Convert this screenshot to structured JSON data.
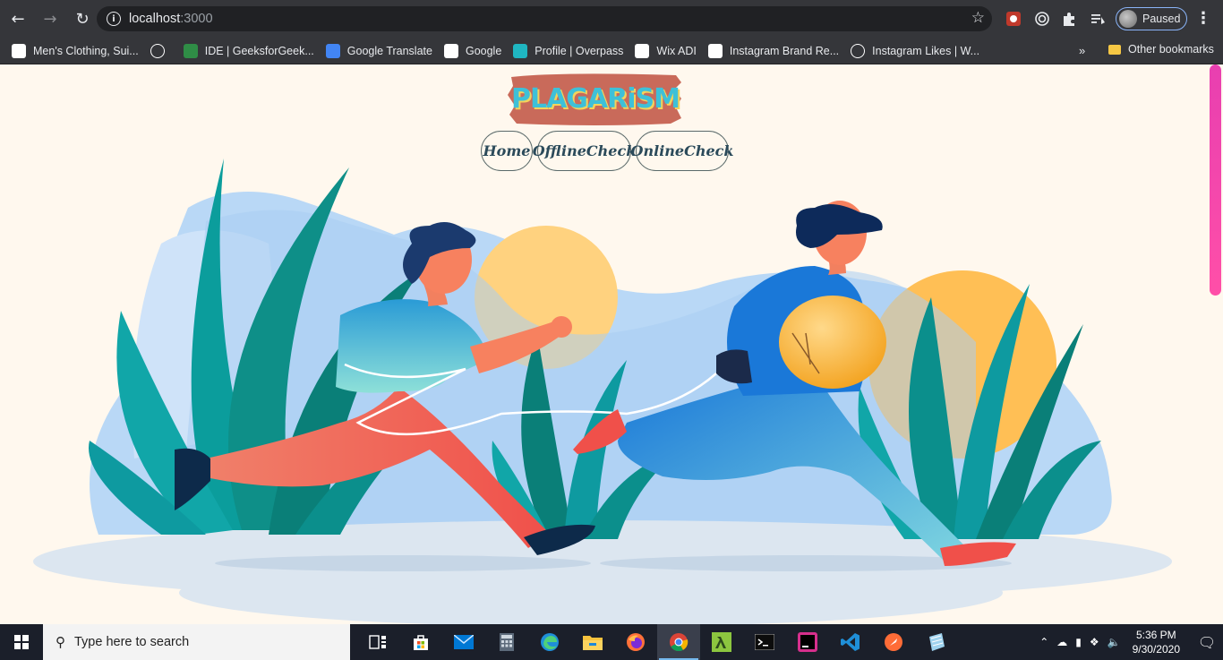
{
  "browser": {
    "url_host": "localhost",
    "url_port": ":3000",
    "profile_label": "Paused"
  },
  "bookmarks": [
    {
      "label": "Men's Clothing, Sui...",
      "icon": "stylized-s-icon",
      "color": "#ffffff"
    },
    {
      "label": "",
      "icon": "globe-icon",
      "color": "#ffffff"
    },
    {
      "label": "IDE | GeeksforGeek...",
      "icon": "geeksforgeeks-icon",
      "color": "#2f8d46"
    },
    {
      "label": "Google Translate",
      "icon": "google-translate-icon",
      "color": "#4285f4"
    },
    {
      "label": "Google",
      "icon": "google-icon",
      "color": "#ffffff"
    },
    {
      "label": "Profile | Overpass",
      "icon": "overpass-icon",
      "color": "#1fb6c1"
    },
    {
      "label": "Wix ADI",
      "icon": "wix-icon",
      "color": "#ffffff"
    },
    {
      "label": "Instagram Brand Re...",
      "icon": "instagram-icon",
      "color": "#ffffff"
    },
    {
      "label": "Instagram Likes | W...",
      "icon": "globe-icon",
      "color": "#ffffff"
    }
  ],
  "bookmarks_more": "»",
  "bookmarks_other": "Other bookmarks",
  "page": {
    "logo_text": "PLAGARiSM",
    "nav": [
      {
        "label": "Home"
      },
      {
        "label": "OfflineCheck"
      },
      {
        "label": "OnlineCheck"
      }
    ]
  },
  "taskbar": {
    "search_placeholder": "Type here to search",
    "apps": [
      "task-view-icon",
      "store-icon",
      "mail-icon",
      "calculator-icon",
      "edge-icon",
      "file-explorer-icon",
      "firefox-icon",
      "chrome-icon",
      "lambda-app-icon",
      "terminal-icon",
      "jetbrains-icon",
      "vscode-icon",
      "postman-icon",
      "notepad-icon"
    ],
    "time": "5:36 PM",
    "date": "9/30/2020"
  }
}
